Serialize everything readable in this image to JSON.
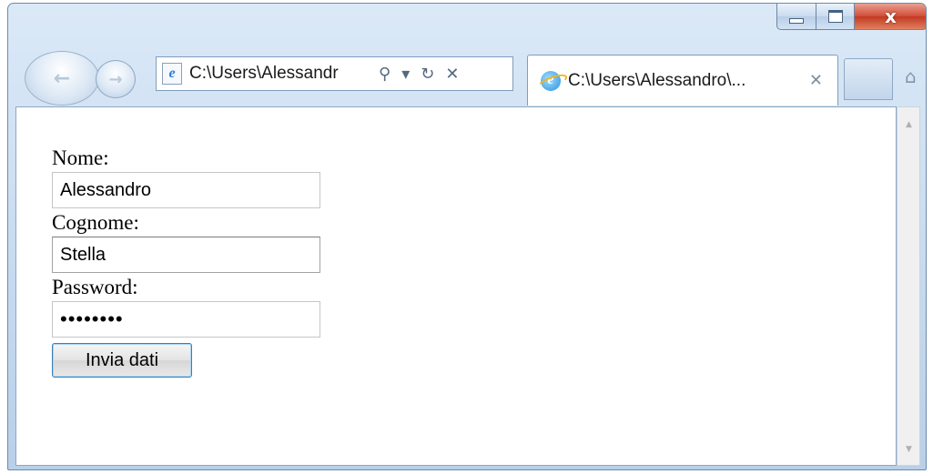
{
  "browser": {
    "address_text": "C:\\Users\\Alessandr",
    "tab_title": "C:\\Users\\Alessandro\\...",
    "controls": {
      "search_icon": "⚲",
      "dropdown_icon": "▾",
      "refresh_icon": "↻",
      "stop_icon": "✕",
      "tab_close_icon": "✕",
      "window_close_icon": "x"
    }
  },
  "form": {
    "nome_label": "Nome:",
    "nome_value": "Alessandro",
    "cognome_label": "Cognome:",
    "cognome_value": "Stella",
    "password_label": "Password:",
    "password_value": "••••••••",
    "submit_label": "Invia dati"
  }
}
